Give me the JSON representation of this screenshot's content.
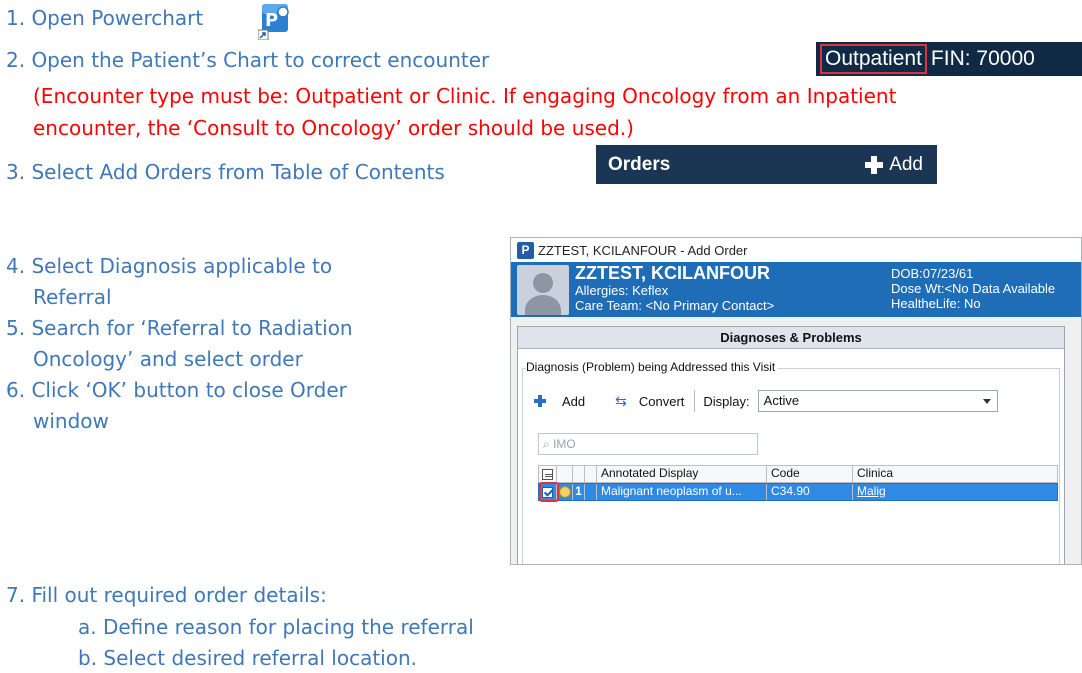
{
  "steps": [
    {
      "text": "1.  Open Powerchart"
    },
    {
      "text": "2.  Open the Patient’s Chart to correct encounter"
    },
    {
      "text": "3.  Select Add Orders from Table of Contents"
    },
    {
      "text": "4.  Select Diagnosis applicable to"
    },
    {
      "text": "Referral"
    },
    {
      "text": "5.  Search for ‘Referral to Radiation"
    },
    {
      "text": "Oncology’ and select order"
    },
    {
      "text": "6.  Click ‘OK’ button to close Order"
    },
    {
      "text": "window"
    },
    {
      "text": "7.  Fill out required order details:"
    },
    {
      "text": "a.   Define reason for placing the referral"
    },
    {
      "text": "b.   Select desired referral location."
    }
  ],
  "note": {
    "line1": "(Encounter type must be: Outpatient or Clinic. If engaging Oncology from an Inpatient",
    "line2": "encounter, the ‘Consult to Oncology’ order should be used.)"
  },
  "encounter": {
    "type": "Outpatient",
    "fin": "FIN: 70000"
  },
  "orders_bar": {
    "title": "Orders",
    "add_label": "Add"
  },
  "window": {
    "title": "ZZTEST, KCILANFOUR - Add Order",
    "badge": "P",
    "patient": {
      "name": "ZZTEST, KCILANFOUR",
      "allergies": "Allergies: Keflex",
      "care_team": "Care Team: <No Primary Contact>",
      "dob": "DOB:07/23/61",
      "dose_wt": "Dose Wt:<No Data Available",
      "healthelife": "HealtheLife: No"
    },
    "panel_title": "Diagnoses & Problems",
    "group_label": "Diagnosis (Problem) being Addressed this Visit",
    "toolbar": {
      "add": "Add",
      "convert": "Convert",
      "display_label": "Display:",
      "display_value": "Active"
    },
    "search_placeholder": "IMO",
    "columns": {
      "annotated": "Annotated Display",
      "code": "Code",
      "clinical": "Clinica"
    },
    "row": {
      "num": "1",
      "display": "Malignant neoplasm of u...",
      "code": "C34.90",
      "clinical": "Malig"
    }
  }
}
